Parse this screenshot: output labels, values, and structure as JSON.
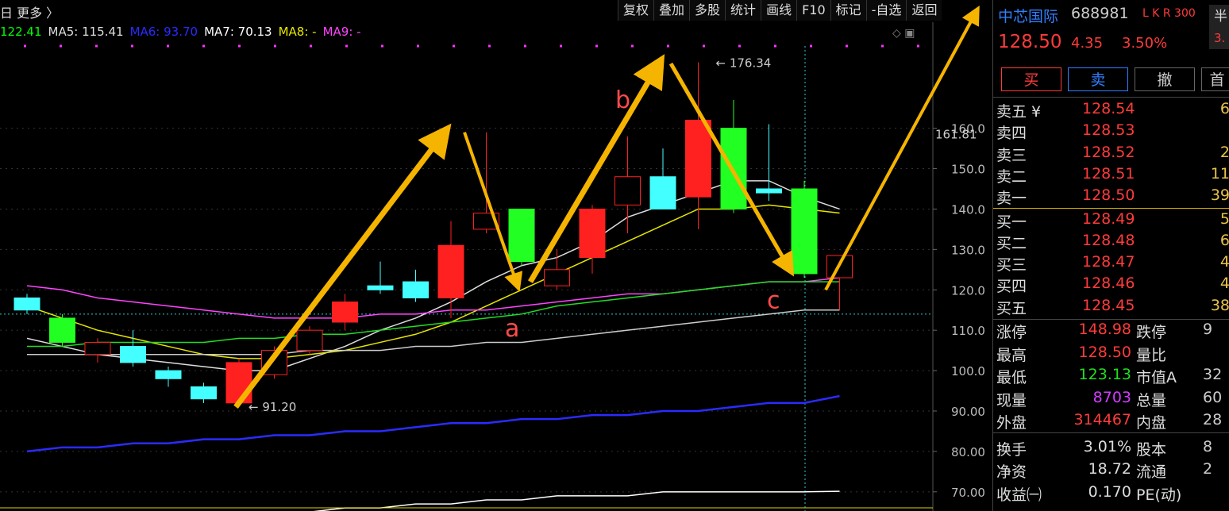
{
  "toolbar": {
    "period_label": "日 更多 〉",
    "buttons": [
      "复权",
      "叠加",
      "多股",
      "统计",
      "画线",
      "F10",
      "标记",
      "-自选",
      "返回"
    ]
  },
  "ma_legend": [
    {
      "label": "122.41",
      "color": "#00ff00"
    },
    {
      "label": "MA5: 115.41",
      "color": "#dddddd"
    },
    {
      "label": "MA6: 93.70",
      "color": "#2b2bff"
    },
    {
      "label": "MA7: 70.13",
      "color": "#ffffff"
    },
    {
      "label": "MA8: -",
      "color": "#e6e600"
    },
    {
      "label": "MA9: -",
      "color": "#ff44ff"
    }
  ],
  "axis": {
    "ticks": [
      "160.0",
      "150.0",
      "140.0",
      "130.0",
      "120.0",
      "110.0",
      "100.0",
      "90.00",
      "80.00",
      "70.00"
    ],
    "current_marker": "161.81"
  },
  "chart_data": {
    "type": "candlestick",
    "ylim": [
      68,
      178
    ],
    "high_label": "176.34",
    "low_label": "91.20",
    "annotations": [
      "a",
      "b",
      "c"
    ],
    "candles": [
      {
        "o": 118,
        "c": 115,
        "h": 119,
        "l": 114,
        "color": "cyan"
      },
      {
        "o": 107,
        "c": 113,
        "h": 114,
        "l": 106,
        "color": "green"
      },
      {
        "o": 104,
        "c": 107,
        "h": 108,
        "l": 102,
        "color": "red"
      },
      {
        "o": 106,
        "c": 102,
        "h": 110,
        "l": 101,
        "color": "cyan"
      },
      {
        "o": 100,
        "c": 98,
        "h": 101,
        "l": 96,
        "color": "cyan"
      },
      {
        "o": 96,
        "c": 93,
        "h": 97,
        "l": 92,
        "color": "cyan"
      },
      {
        "o": 92,
        "c": 102,
        "h": 103,
        "l": 91.2,
        "color": "red"
      },
      {
        "o": 99,
        "c": 105,
        "h": 106,
        "l": 98,
        "color": "red"
      },
      {
        "o": 105,
        "c": 110,
        "h": 111,
        "l": 104,
        "color": "red"
      },
      {
        "o": 112,
        "c": 117,
        "h": 119,
        "l": 110,
        "color": "red"
      },
      {
        "o": 121,
        "c": 120,
        "h": 127,
        "l": 119,
        "color": "cyan"
      },
      {
        "o": 122,
        "c": 118,
        "h": 125,
        "l": 117,
        "color": "cyan"
      },
      {
        "o": 118,
        "c": 131,
        "h": 137,
        "l": 113,
        "color": "red"
      },
      {
        "o": 135,
        "c": 139,
        "h": 159,
        "l": 134,
        "color": "red"
      },
      {
        "o": 140,
        "c": 127,
        "h": 140,
        "l": 126,
        "color": "green"
      },
      {
        "o": 121,
        "c": 125,
        "h": 130,
        "l": 120,
        "color": "red"
      },
      {
        "o": 128,
        "c": 140,
        "h": 141,
        "l": 124,
        "color": "red"
      },
      {
        "o": 141,
        "c": 148,
        "h": 158,
        "l": 134,
        "color": "red"
      },
      {
        "o": 148,
        "c": 140,
        "h": 155,
        "l": 140,
        "color": "cyan"
      },
      {
        "o": 143,
        "c": 162,
        "h": 176.34,
        "l": 135,
        "color": "red"
      },
      {
        "o": 160,
        "c": 140,
        "h": 167,
        "l": 139,
        "color": "green"
      },
      {
        "o": 145,
        "c": 144,
        "h": 161,
        "l": 142,
        "color": "cyan"
      },
      {
        "o": 145,
        "c": 124,
        "h": 147,
        "l": 123,
        "color": "green"
      },
      {
        "o": 123,
        "c": 128.5,
        "h": 128.5,
        "l": 115,
        "color": "red"
      }
    ],
    "ma_lines": [
      {
        "name": "MA5",
        "color": "#dddddd",
        "values": [
          108,
          106,
          104,
          103,
          102,
          101,
          100,
          100,
          103,
          106,
          110,
          113,
          117,
          122,
          126,
          128,
          132,
          138,
          141,
          144,
          147,
          147,
          143,
          140
        ]
      },
      {
        "name": "MA8",
        "color": "#e6e600",
        "values": [
          116,
          113,
          110,
          108,
          106,
          104,
          103,
          103,
          104,
          105,
          107,
          109,
          112,
          116,
          120,
          124,
          128,
          132,
          136,
          140,
          140,
          141,
          140,
          139
        ]
      },
      {
        "name": "MA9",
        "color": "#ff44ff",
        "values": [
          121,
          120,
          118,
          117,
          116,
          115,
          114,
          113,
          113,
          113,
          114,
          114,
          115,
          115,
          116,
          117,
          118,
          119,
          119,
          120,
          121,
          122,
          122,
          123
        ]
      },
      {
        "name": "G",
        "color": "#22dd22",
        "values": [
          106,
          106,
          107,
          107,
          107,
          107,
          108,
          108,
          109,
          109,
          110,
          111,
          112,
          113,
          114,
          116,
          117,
          118,
          119,
          120,
          121,
          122,
          122,
          122
        ]
      },
      {
        "name": "MA5b",
        "color": "#cccccc",
        "values": [
          104,
          104,
          104,
          104,
          104,
          104,
          104,
          104,
          105,
          105,
          105,
          106,
          106,
          107,
          107,
          108,
          109,
          110,
          111,
          112,
          113,
          114,
          115,
          115
        ]
      },
      {
        "name": "MA6",
        "color": "#2b2bff",
        "values": [
          80,
          81,
          81,
          82,
          82,
          83,
          83,
          84,
          84,
          85,
          85,
          86,
          87,
          87,
          88,
          88,
          89,
          89,
          90,
          90,
          91,
          92,
          92,
          93.7
        ]
      },
      {
        "name": "MA7",
        "color": "#ffffff",
        "values": [
          62,
          62,
          63,
          63,
          63,
          64,
          64,
          65,
          65,
          66,
          66,
          67,
          67,
          68,
          68,
          69,
          69,
          69,
          70,
          70,
          70,
          70,
          70,
          70.13
        ]
      }
    ]
  },
  "quote": {
    "name": "中芯国际",
    "code": "688981",
    "tag": "L K R 300",
    "half_label": "半",
    "half_small": "3.",
    "price": "128.50",
    "change": "4.35",
    "pct": "3.50%",
    "buttons": {
      "buy": "买",
      "sell": "卖",
      "cancel": "撤",
      "more": "首"
    }
  },
  "orderbook": [
    {
      "label": "卖五 ¥",
      "price": "128.54",
      "vol": "6"
    },
    {
      "label": "卖四",
      "price": "128.53",
      "vol": ""
    },
    {
      "label": "卖三",
      "price": "128.52",
      "vol": "2"
    },
    {
      "label": "卖二",
      "price": "128.51",
      "vol": "11"
    },
    {
      "label": "卖一",
      "price": "128.50",
      "vol": "39"
    },
    {
      "label": "买一",
      "price": "128.49",
      "vol": "5"
    },
    {
      "label": "买二",
      "price": "128.48",
      "vol": "6"
    },
    {
      "label": "买三",
      "price": "128.47",
      "vol": "4"
    },
    {
      "label": "买四",
      "price": "128.46",
      "vol": "4"
    },
    {
      "label": "买五",
      "price": "128.45",
      "vol": "38"
    }
  ],
  "stats": [
    {
      "l1": "涨停",
      "v1": "148.98",
      "c1": "#ff3b3b",
      "l2": "跌停",
      "v2": "9"
    },
    {
      "l1": "最高",
      "v1": "128.50",
      "c1": "#ff3b3b",
      "l2": "量比",
      "v2": ""
    },
    {
      "l1": "最低",
      "v1": "123.13",
      "c1": "#22dd22",
      "l2": "市值A",
      "v2": "32"
    },
    {
      "l1": "现量",
      "v1": "8703",
      "c1": "#d23cff",
      "l2": "总量",
      "v2": "60"
    },
    {
      "l1": "外盘",
      "v1": "314467",
      "c1": "#ff3b3b",
      "l2": "内盘",
      "v2": "28"
    },
    {
      "l1": "换手",
      "v1": "3.01%",
      "c1": "#dddddd",
      "l2": "股本",
      "v2": "8"
    },
    {
      "l1": "净资",
      "v1": "18.72",
      "c1": "#dddddd",
      "l2": "流通",
      "v2": "2"
    },
    {
      "l1": "收益㈠",
      "v1": "0.170",
      "c1": "#dddddd",
      "l2": "PE(动)",
      "v2": ""
    }
  ]
}
